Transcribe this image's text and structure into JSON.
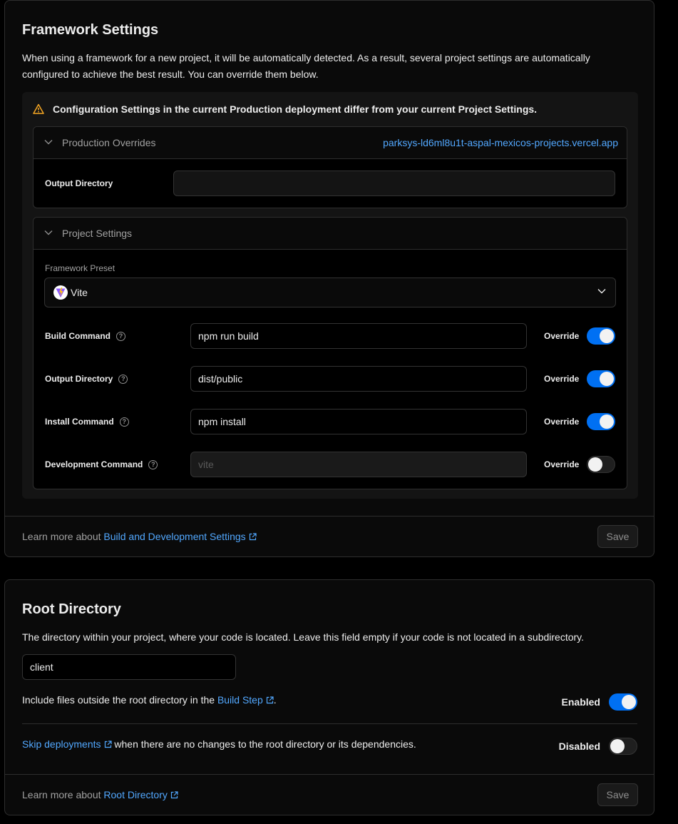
{
  "framework": {
    "title": "Framework Settings",
    "description": "When using a framework for a new project, it will be automatically detected. As a result, several project settings are automatically configured to achieve the best result. You can override them below.",
    "warning": "Configuration Settings in the current Production deployment differ from your current Project Settings.",
    "production_overrides": {
      "label": "Production Overrides",
      "deployment_link": "parksys-ld6ml8u1t-aspal-mexicos-projects.vercel.app",
      "output_directory_label": "Output Directory",
      "output_directory_value": ""
    },
    "project_settings": {
      "label": "Project Settings",
      "preset_label": "Framework Preset",
      "preset_value": "Vite",
      "rows": [
        {
          "label": "Build Command",
          "value": "npm run build",
          "placeholder": "",
          "override": true
        },
        {
          "label": "Output Directory",
          "value": "dist/public",
          "placeholder": "",
          "override": true
        },
        {
          "label": "Install Command",
          "value": "npm install",
          "placeholder": "",
          "override": true
        },
        {
          "label": "Development Command",
          "value": "",
          "placeholder": "vite",
          "override": false
        }
      ],
      "override_label": "Override"
    },
    "footer": {
      "prefix": "Learn more about ",
      "link": "Build and Development Settings",
      "save": "Save"
    }
  },
  "root_directory": {
    "title": "Root Directory",
    "description": "The directory within your project, where your code is located. Leave this field empty if your code is not located in a subdirectory.",
    "value": "client",
    "include_files": {
      "prefix": "Include files outside the root directory in the ",
      "link": "Build Step",
      "suffix": ".",
      "status": "Enabled",
      "enabled": true
    },
    "skip_deployments": {
      "link": "Skip deployments",
      "suffix": " when there are no changes to the root directory or its dependencies.",
      "status": "Disabled",
      "enabled": false
    },
    "footer": {
      "prefix": "Learn more about ",
      "link": "Root Directory",
      "save": "Save"
    }
  },
  "colors": {
    "accent": "#0070f3",
    "link": "#52a8ff",
    "warning": "#f5a623",
    "background": "#000000"
  }
}
